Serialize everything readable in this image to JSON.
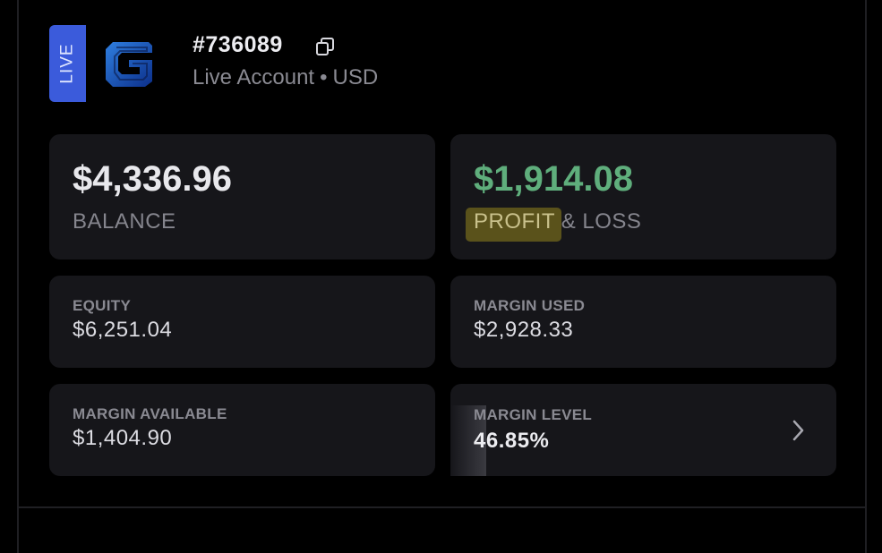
{
  "header": {
    "badge": "LIVE",
    "account_id": "#736089",
    "account_type": "Live Account",
    "separator": "•",
    "currency": "USD",
    "icons": {
      "logo": "broker-logo-icon",
      "copy": "copy-icon"
    }
  },
  "cards": {
    "balance": {
      "value": "$4,336.96",
      "label": "BALANCE"
    },
    "pnl": {
      "value": "$1,914.08",
      "label_highlight": "PROFIT",
      "label_rest": " & LOSS"
    },
    "equity": {
      "label": "EQUITY",
      "value": "$6,251.04"
    },
    "margin_used": {
      "label": "MARGIN USED",
      "value": "$2,928.33"
    },
    "margin_available": {
      "label": "MARGIN AVAILABLE",
      "value": "$1,404.90"
    },
    "margin_level": {
      "label": "MARGIN LEVEL",
      "value": "46.85%",
      "icon": "chevron-right-icon"
    }
  },
  "colors": {
    "background": "#000000",
    "card": "#16161a",
    "badge": "#3b5bdb",
    "profit_green": "#5fae7c",
    "highlight": "#5a521b"
  }
}
